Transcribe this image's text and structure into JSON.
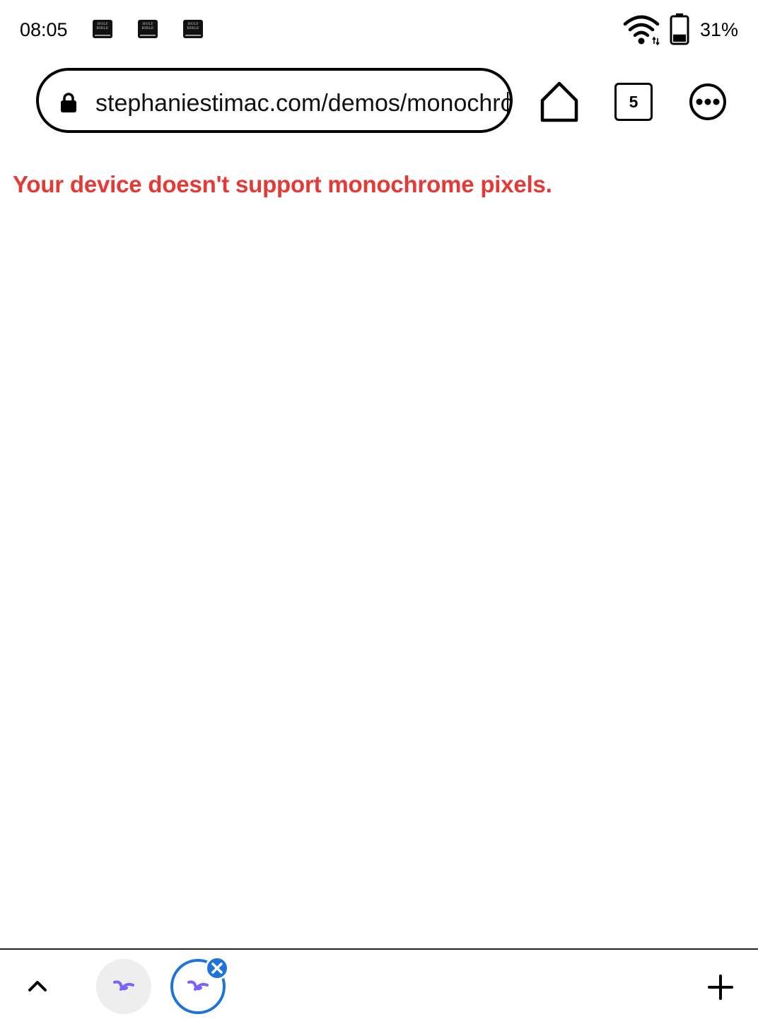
{
  "status_bar": {
    "time": "08:05",
    "notification_icons": [
      {
        "icon": "bible-app-icon",
        "label": "HOLY BIBLE"
      },
      {
        "icon": "bible-app-icon",
        "label": "HOLY BIBLE"
      },
      {
        "icon": "bible-app-icon",
        "label": "HOLY BIBLE"
      }
    ],
    "wifi_icon": "wifi-icon",
    "battery_icon": "battery-icon",
    "battery_level": 0.31,
    "battery_text": "31%"
  },
  "toolbar": {
    "url": "stephaniestimac.com/demos/monochrome",
    "home_icon": "home-icon",
    "tab_count": "5",
    "more_icon": "more-dots-icon"
  },
  "content": {
    "error_message": "Your device doesn't support monochrome pixels."
  },
  "colors": {
    "error": "#e53935",
    "active_tab_accent": "#1e74d9",
    "favicon": "#7b61ff"
  },
  "bottom_bar": {
    "expand_icon": "chevron-up-icon",
    "tabs": [
      {
        "favicon": "squiggle-favicon-icon",
        "active": false
      },
      {
        "favicon": "squiggle-favicon-icon",
        "active": true,
        "close_icon": "close-icon"
      }
    ],
    "new_tab_icon": "plus-icon"
  }
}
